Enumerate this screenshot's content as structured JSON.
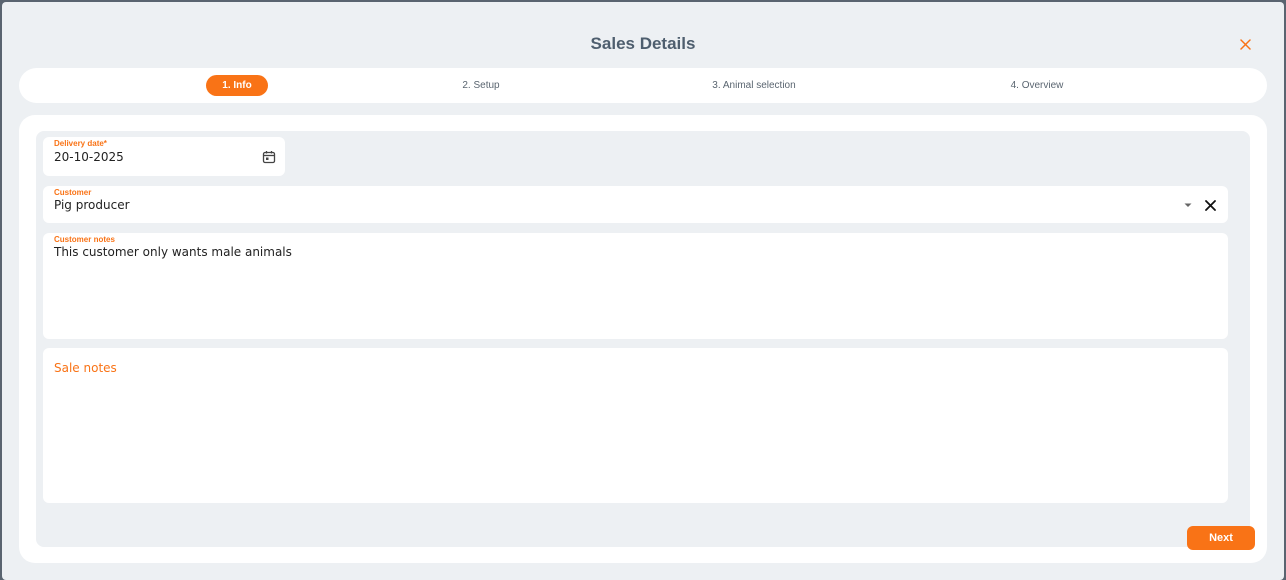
{
  "dialog": {
    "title": "Sales Details"
  },
  "stepper": {
    "steps": [
      {
        "label": "1. Info",
        "active": true
      },
      {
        "label": "2. Setup",
        "active": false
      },
      {
        "label": "3. Animal selection",
        "active": false
      },
      {
        "label": "4. Overview",
        "active": false
      }
    ]
  },
  "form": {
    "delivery_date": {
      "label": "Delivery date*",
      "value": "20-10-2025",
      "icon": "calendar-icon"
    },
    "customer": {
      "label": "Customer",
      "value": "Pig producer",
      "icons": [
        "dropdown-arrow-icon",
        "clear-icon"
      ]
    },
    "customer_notes": {
      "label": "Customer notes",
      "value": "This customer only wants male animals"
    },
    "sale_notes": {
      "label": "Sale notes",
      "value": ""
    }
  },
  "actions": {
    "next_label": "Next"
  },
  "colors": {
    "accent": "#f97316",
    "background": "#edf0f3",
    "title": "#4e5e6e"
  }
}
